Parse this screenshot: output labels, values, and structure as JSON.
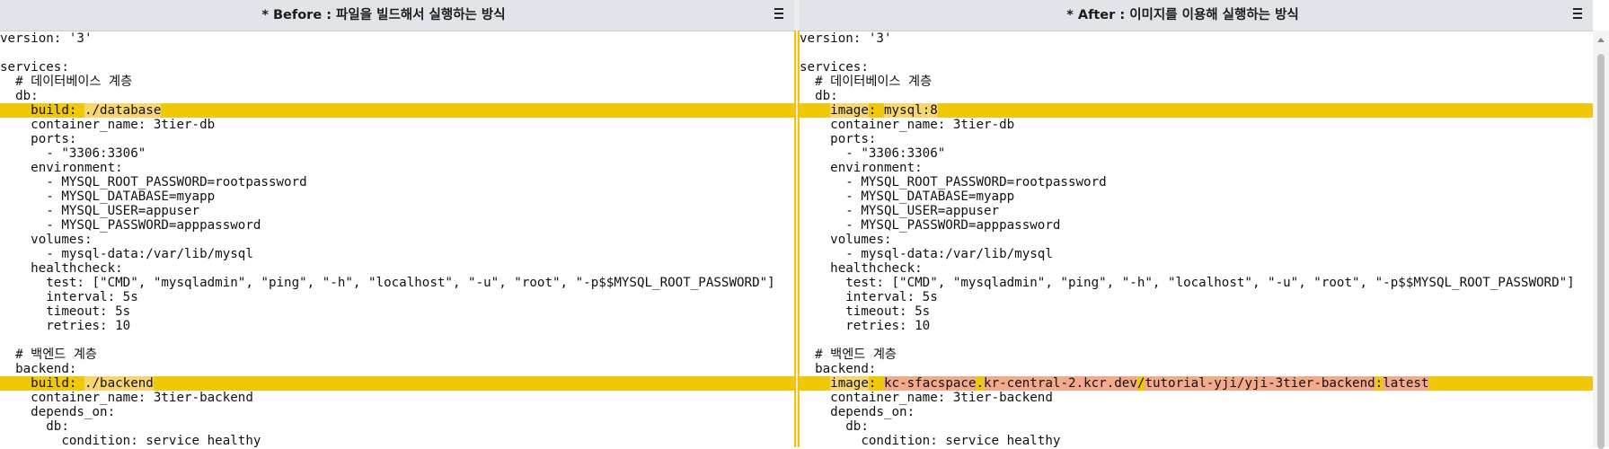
{
  "left": {
    "title": "* Before : 파일을 빌드해서 실행하는 방식",
    "lines": [
      {
        "segs": [
          {
            "t": "version: '3'"
          }
        ]
      },
      {
        "segs": [
          {
            "t": ""
          }
        ]
      },
      {
        "segs": [
          {
            "t": "services:"
          }
        ]
      },
      {
        "segs": [
          {
            "t": "  # 데이터베이스 계층"
          }
        ]
      },
      {
        "segs": [
          {
            "t": "  db:"
          }
        ]
      },
      {
        "hl": true,
        "segs": [
          {
            "t": "    build",
            "c": "key"
          },
          {
            "t": ": "
          },
          {
            "t": "./database",
            "c": "hl"
          }
        ]
      },
      {
        "segs": [
          {
            "t": "    container_name: 3tier-db"
          }
        ]
      },
      {
        "segs": [
          {
            "t": "    ports:"
          }
        ]
      },
      {
        "segs": [
          {
            "t": "      - \"3306:3306\""
          }
        ]
      },
      {
        "segs": [
          {
            "t": "    environment:"
          }
        ]
      },
      {
        "segs": [
          {
            "t": "      - MYSQL_ROOT_PASSWORD=rootpassword"
          }
        ]
      },
      {
        "segs": [
          {
            "t": "      - MYSQL_DATABASE=myapp"
          }
        ]
      },
      {
        "segs": [
          {
            "t": "      - MYSQL_USER=appuser"
          }
        ]
      },
      {
        "segs": [
          {
            "t": "      - MYSQL_PASSWORD=apppassword"
          }
        ]
      },
      {
        "segs": [
          {
            "t": "    volumes:"
          }
        ]
      },
      {
        "segs": [
          {
            "t": "      - mysql-data:/var/lib/mysql"
          }
        ]
      },
      {
        "segs": [
          {
            "t": "    healthcheck:"
          }
        ]
      },
      {
        "segs": [
          {
            "t": "      test: [\"CMD\", \"mysqladmin\", \"ping\", \"-h\", \"localhost\", \"-u\", \"root\", \"-p$$MYSQL_ROOT_PASSWORD\"]"
          }
        ]
      },
      {
        "segs": [
          {
            "t": "      interval: 5s"
          }
        ]
      },
      {
        "segs": [
          {
            "t": "      timeout: 5s"
          }
        ]
      },
      {
        "segs": [
          {
            "t": "      retries: 10"
          }
        ]
      },
      {
        "segs": [
          {
            "t": ""
          }
        ]
      },
      {
        "segs": [
          {
            "t": "  # 백엔드 계층"
          }
        ]
      },
      {
        "segs": [
          {
            "t": "  backend:"
          }
        ]
      },
      {
        "hl": true,
        "segs": [
          {
            "t": "    build",
            "c": "key"
          },
          {
            "t": ": "
          },
          {
            "t": "./backend",
            "c": "hl"
          }
        ]
      },
      {
        "segs": [
          {
            "t": "    container_name: 3tier-backend"
          }
        ]
      },
      {
        "segs": [
          {
            "t": "    depends_on:"
          }
        ]
      },
      {
        "segs": [
          {
            "t": "      db:"
          }
        ]
      },
      {
        "segs": [
          {
            "t": "        condition: service_healthy"
          }
        ]
      }
    ]
  },
  "right": {
    "title": "* After : 이미지를 이용해 실행하는 방식",
    "lines": [
      {
        "segs": [
          {
            "t": "version: '3'"
          }
        ]
      },
      {
        "segs": [
          {
            "t": ""
          }
        ]
      },
      {
        "segs": [
          {
            "t": "services:"
          }
        ]
      },
      {
        "segs": [
          {
            "t": "  # 데이터베이스 계층"
          }
        ]
      },
      {
        "segs": [
          {
            "t": "  db:"
          }
        ]
      },
      {
        "hl": true,
        "segs": [
          {
            "t": "    "
          },
          {
            "t": "image",
            "c": "hl"
          },
          {
            "t": ": "
          },
          {
            "t": "mysql:8",
            "c": "hl"
          }
        ]
      },
      {
        "segs": [
          {
            "t": "    container_name: 3tier-db"
          }
        ]
      },
      {
        "segs": [
          {
            "t": "    ports:"
          }
        ]
      },
      {
        "segs": [
          {
            "t": "      - \"3306:3306\""
          }
        ]
      },
      {
        "segs": [
          {
            "t": "    environment:"
          }
        ]
      },
      {
        "segs": [
          {
            "t": "      - MYSQL_ROOT_PASSWORD=rootpassword"
          }
        ]
      },
      {
        "segs": [
          {
            "t": "      - MYSQL_DATABASE=myapp"
          }
        ]
      },
      {
        "segs": [
          {
            "t": "      - MYSQL_USER=appuser"
          }
        ]
      },
      {
        "segs": [
          {
            "t": "      - MYSQL_PASSWORD=apppassword"
          }
        ]
      },
      {
        "segs": [
          {
            "t": "    volumes:"
          }
        ]
      },
      {
        "segs": [
          {
            "t": "      - mysql-data:/var/lib/mysql"
          }
        ]
      },
      {
        "segs": [
          {
            "t": "    healthcheck:"
          }
        ]
      },
      {
        "segs": [
          {
            "t": "      test: [\"CMD\", \"mysqladmin\", \"ping\", \"-h\", \"localhost\", \"-u\", \"root\", \"-p$$MYSQL_ROOT_PASSWORD\"]"
          }
        ]
      },
      {
        "segs": [
          {
            "t": "      interval: 5s"
          }
        ]
      },
      {
        "segs": [
          {
            "t": "      timeout: 5s"
          }
        ]
      },
      {
        "segs": [
          {
            "t": "      retries: 10"
          }
        ]
      },
      {
        "segs": [
          {
            "t": ""
          }
        ]
      },
      {
        "segs": [
          {
            "t": "  # 백엔드 계층"
          }
        ]
      },
      {
        "segs": [
          {
            "t": "  backend:"
          }
        ]
      },
      {
        "hl": true,
        "segs": [
          {
            "t": "    "
          },
          {
            "t": "image",
            "c": "hl"
          },
          {
            "t": ": "
          },
          {
            "t": "kc-sfacspace",
            "c": "val"
          },
          {
            "t": "."
          },
          {
            "t": "kr-central-2.kcr.dev",
            "c": "val"
          },
          {
            "t": "/"
          },
          {
            "t": "tutorial-yji/yji-3tier-backend",
            "c": "val"
          },
          {
            "t": ":"
          },
          {
            "t": "latest",
            "c": "val"
          }
        ]
      },
      {
        "segs": [
          {
            "t": "    container_name: 3tier-backend"
          }
        ]
      },
      {
        "segs": [
          {
            "t": "    depends_on:"
          }
        ]
      },
      {
        "segs": [
          {
            "t": "      db:"
          }
        ]
      },
      {
        "segs": [
          {
            "t": "        condition: service_healthy"
          }
        ]
      }
    ]
  },
  "colors": {
    "header_bg": "#e1e4e9",
    "line_highlight": "#f0c808",
    "token_highlight": "#f7d76b",
    "value_highlight": "#f3a98a"
  },
  "icons": {
    "menu": "hamburger-menu-icon"
  }
}
